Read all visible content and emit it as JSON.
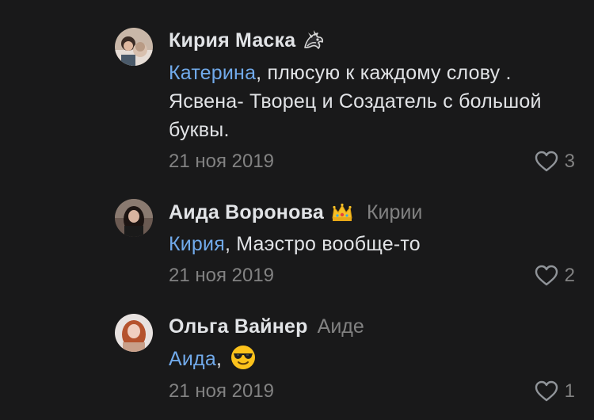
{
  "comments": [
    {
      "author": "Кирия Маска",
      "badge_icon": "dragon-badge-icon",
      "reply_to": "",
      "mention": "Катерина",
      "text": ", плюсую к каждому слову . Ясвена- Творец и Создатель с большой буквы.",
      "date": "21 ноя 2019",
      "likes": "3"
    },
    {
      "author": "Аида Воронова",
      "badge_icon": "crown-badge-icon",
      "reply_to": "Кирии",
      "mention": "Кирия",
      "text": ", Маэстро вообще-то",
      "date": "21 ноя 2019",
      "likes": "2"
    },
    {
      "author": "Ольга Вайнер",
      "badge_icon": "",
      "reply_to": "Аиде",
      "mention": "Аида",
      "text": ",",
      "emoji": "sunglasses-emoji-icon",
      "date": "21 ноя 2019",
      "likes": "1"
    }
  ],
  "colors": {
    "background": "#19191a",
    "text": "#e1e3e6",
    "secondary": "#828282",
    "link": "#71aaeb"
  }
}
